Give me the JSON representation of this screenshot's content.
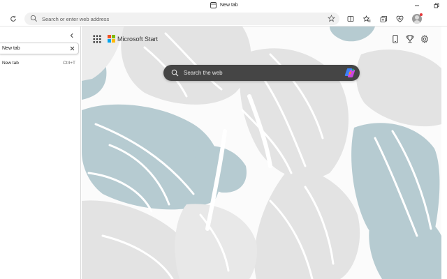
{
  "window": {
    "title": "New tab",
    "minimize_icon": "minimize-icon",
    "restore_icon": "restore-icon"
  },
  "toolbar": {
    "refresh_icon": "refresh-icon",
    "address_placeholder": "Search or enter web address",
    "favorite_icon": "star-outline-icon",
    "icons": [
      "split-screen-icon",
      "favorites-icon",
      "collections-icon",
      "browser-essentials-icon",
      "profile-avatar"
    ]
  },
  "vertical_tabs": {
    "collapse_icon": "chevron-left-icon",
    "tabs": [
      {
        "title": "New tab",
        "active": true
      }
    ],
    "suggestion": {
      "title": "New tab",
      "shortcut": "Ctrl+T"
    }
  },
  "new_tab_page": {
    "brand": "Microsoft Start",
    "search_placeholder": "Search the web",
    "top_icons": [
      "mobile-icon",
      "rewards-trophy-icon",
      "settings-gear-icon"
    ],
    "colors": {
      "search_bg": "#454545",
      "art_teal": "#b6cbd1",
      "art_gray": "#e3e3e3",
      "logo_red": "#f25022",
      "logo_green": "#7fba00",
      "logo_blue": "#00a4ef",
      "logo_yellow": "#ffb900"
    }
  }
}
